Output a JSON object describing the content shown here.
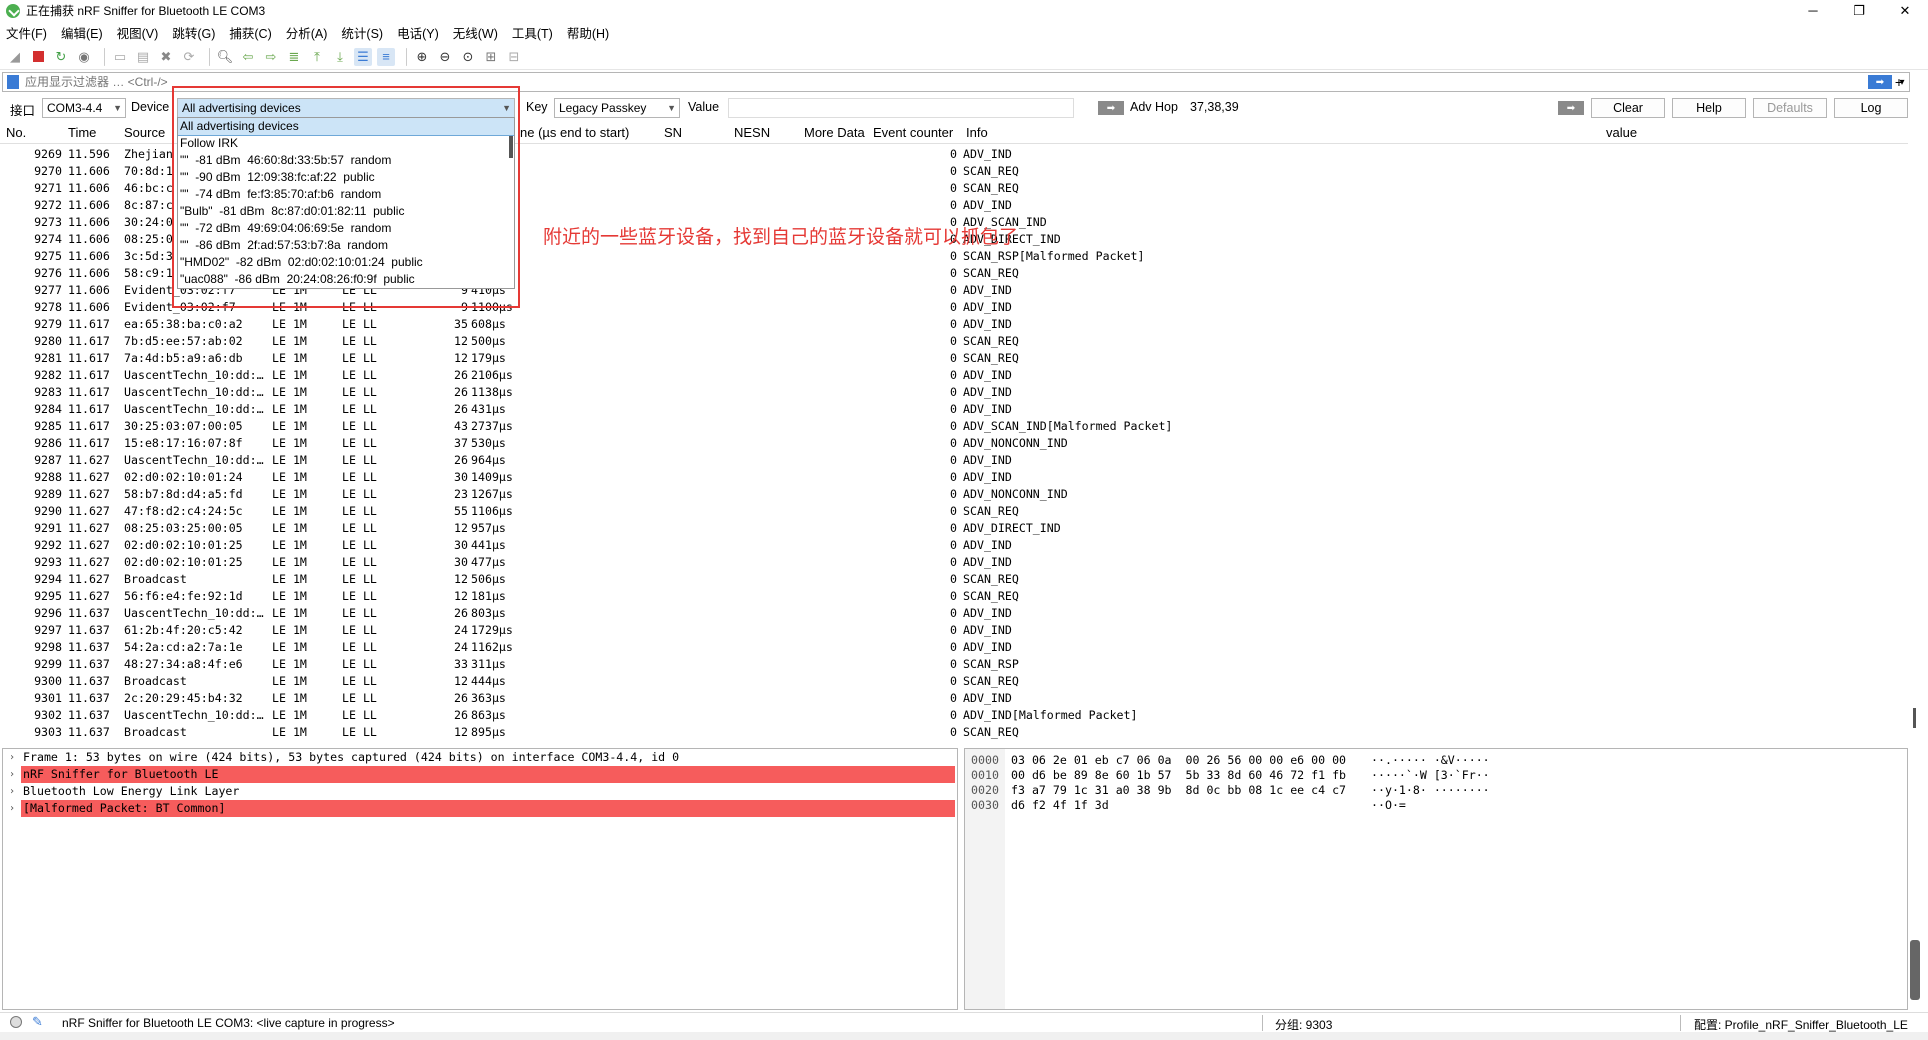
{
  "window": {
    "title": "正在捕获 nRF Sniffer for Bluetooth LE COM3",
    "controls": [
      "─",
      "❐",
      "✕"
    ]
  },
  "menu": [
    "文件(F)",
    "编辑(E)",
    "视图(V)",
    "跳转(G)",
    "捕获(C)",
    "分析(A)",
    "统计(S)",
    "电话(Y)",
    "无线(W)",
    "工具(T)",
    "帮助(H)"
  ],
  "toolbar_icons": [
    "shark-fin-icon",
    "stop-icon",
    "restart-icon",
    "options-icon",
    "open-icon",
    "save-icon",
    "close-file-icon",
    "reload-icon",
    "find-icon",
    "back-icon",
    "forward-icon",
    "goto-icon",
    "first-icon",
    "last-icon",
    "autoscroll-icon",
    "colorize-icon",
    "zoom-in-icon",
    "zoom-out-icon",
    "zoom-reset-icon",
    "resize-columns-icon",
    "layout-icon"
  ],
  "filter": {
    "placeholder": "应用显示过滤器 … <Ctrl-/>",
    "plus": "+"
  },
  "sniffer": {
    "interface_label": "接口",
    "interface_value": "COM3-4.4",
    "device_label": "Device",
    "device_value": "All advertising devices",
    "key_label": "Key",
    "key_value": "Legacy Passkey",
    "value_label": "Value",
    "adv_hop_label": "Adv Hop",
    "adv_hop_value": "37,38,39",
    "clear": "Clear",
    "help": "Help",
    "defaults": "Defaults",
    "log": "Log"
  },
  "columns": {
    "no": "No.",
    "time": "Time",
    "source": "Source",
    "delta": "ne (µs end to start)",
    "sn": "SN",
    "nesn": "NESN",
    "more_data": "More Data",
    "event_counter": "Event counter",
    "info": "Info",
    "value": "value"
  },
  "packets": [
    {
      "no": "9269",
      "time": "11.596",
      "src": "Zhejian",
      "p1": "",
      "p2": "",
      "len": "",
      "dt": "",
      "ec": "0",
      "info": "ADV_IND"
    },
    {
      "no": "9270",
      "time": "11.606",
      "src": "70:8d:1",
      "p1": "",
      "p2": "",
      "len": "",
      "dt": "",
      "ec": "0",
      "info": "SCAN_REQ"
    },
    {
      "no": "9271",
      "time": "11.606",
      "src": "46:bc:c",
      "p1": "",
      "p2": "",
      "len": "",
      "dt": "",
      "ec": "0",
      "info": "SCAN_REQ"
    },
    {
      "no": "9272",
      "time": "11.606",
      "src": "8c:87:c",
      "p1": "",
      "p2": "",
      "len": "",
      "dt": "",
      "ec": "0",
      "info": "ADV_IND"
    },
    {
      "no": "9273",
      "time": "11.606",
      "src": "30:24:0",
      "p1": "",
      "p2": "",
      "len": "",
      "dt": "",
      "ec": "0",
      "info": "ADV_SCAN_IND"
    },
    {
      "no": "9274",
      "time": "11.606",
      "src": "08:25:0",
      "p1": "",
      "p2": "",
      "len": "",
      "dt": "",
      "ec": "0",
      "info": "ADV_DIRECT_IND"
    },
    {
      "no": "9275",
      "time": "11.606",
      "src": "3c:5d:3",
      "p1": "",
      "p2": "",
      "len": "",
      "dt": "",
      "ec": "0",
      "info": "SCAN_RSP[Malformed Packet]"
    },
    {
      "no": "9276",
      "time": "11.606",
      "src": "58:c9:1",
      "p1": "",
      "p2": "",
      "len": "",
      "dt": "",
      "ec": "0",
      "info": "SCAN_REQ"
    },
    {
      "no": "9277",
      "time": "11.606",
      "src": "Evident_03:02:f7",
      "p1": "LE 1M",
      "p2": "LE LL",
      "len": "9",
      "dt": "410µs",
      "ec": "0",
      "info": "ADV_IND"
    },
    {
      "no": "9278",
      "time": "11.606",
      "src": "Evident_03:02:f7",
      "p1": "LE 1M",
      "p2": "LE LL",
      "len": "9",
      "dt": "1100µs",
      "ec": "0",
      "info": "ADV_IND"
    },
    {
      "no": "9279",
      "time": "11.617",
      "src": "ea:65:38:ba:c0:a2",
      "p1": "LE 1M",
      "p2": "LE LL",
      "len": "35",
      "dt": "608µs",
      "ec": "0",
      "info": "ADV_IND"
    },
    {
      "no": "9280",
      "time": "11.617",
      "src": "7b:d5:ee:57:ab:02",
      "p1": "LE 1M",
      "p2": "LE LL",
      "len": "12",
      "dt": "500µs",
      "ec": "0",
      "info": "SCAN_REQ"
    },
    {
      "no": "9281",
      "time": "11.617",
      "src": "7a:4d:b5:a9:a6:db",
      "p1": "LE 1M",
      "p2": "LE LL",
      "len": "12",
      "dt": "179µs",
      "ec": "0",
      "info": "SCAN_REQ"
    },
    {
      "no": "9282",
      "time": "11.617",
      "src": "UascentTechn_10:dd:…",
      "p1": "LE 1M",
      "p2": "LE LL",
      "len": "26",
      "dt": "2106µs",
      "ec": "0",
      "info": "ADV_IND"
    },
    {
      "no": "9283",
      "time": "11.617",
      "src": "UascentTechn_10:dd:…",
      "p1": "LE 1M",
      "p2": "LE LL",
      "len": "26",
      "dt": "1138µs",
      "ec": "0",
      "info": "ADV_IND"
    },
    {
      "no": "9284",
      "time": "11.617",
      "src": "UascentTechn_10:dd:…",
      "p1": "LE 1M",
      "p2": "LE LL",
      "len": "26",
      "dt": "431µs",
      "ec": "0",
      "info": "ADV_IND"
    },
    {
      "no": "9285",
      "time": "11.617",
      "src": "30:25:03:07:00:05",
      "p1": "LE 1M",
      "p2": "LE LL",
      "len": "43",
      "dt": "2737µs",
      "ec": "0",
      "info": "ADV_SCAN_IND[Malformed Packet]"
    },
    {
      "no": "9286",
      "time": "11.617",
      "src": "15:e8:17:16:07:8f",
      "p1": "LE 1M",
      "p2": "LE LL",
      "len": "37",
      "dt": "530µs",
      "ec": "0",
      "info": "ADV_NONCONN_IND"
    },
    {
      "no": "9287",
      "time": "11.627",
      "src": "UascentTechn_10:dd:…",
      "p1": "LE 1M",
      "p2": "LE LL",
      "len": "26",
      "dt": "964µs",
      "ec": "0",
      "info": "ADV_IND"
    },
    {
      "no": "9288",
      "time": "11.627",
      "src": "02:d0:02:10:01:24",
      "p1": "LE 1M",
      "p2": "LE LL",
      "len": "30",
      "dt": "1409µs",
      "ec": "0",
      "info": "ADV_IND"
    },
    {
      "no": "9289",
      "time": "11.627",
      "src": "58:b7:8d:d4:a5:fd",
      "p1": "LE 1M",
      "p2": "LE LL",
      "len": "23",
      "dt": "1267µs",
      "ec": "0",
      "info": "ADV_NONCONN_IND"
    },
    {
      "no": "9290",
      "time": "11.627",
      "src": "47:f8:d2:c4:24:5c",
      "p1": "LE 1M",
      "p2": "LE LL",
      "len": "55",
      "dt": "1106µs",
      "ec": "0",
      "info": "SCAN_REQ"
    },
    {
      "no": "9291",
      "time": "11.627",
      "src": "08:25:03:25:00:05",
      "p1": "LE 1M",
      "p2": "LE LL",
      "len": "12",
      "dt": "957µs",
      "ec": "0",
      "info": "ADV_DIRECT_IND"
    },
    {
      "no": "9292",
      "time": "11.627",
      "src": "02:d0:02:10:01:25",
      "p1": "LE 1M",
      "p2": "LE LL",
      "len": "30",
      "dt": "441µs",
      "ec": "0",
      "info": "ADV_IND"
    },
    {
      "no": "9293",
      "time": "11.627",
      "src": "02:d0:02:10:01:25",
      "p1": "LE 1M",
      "p2": "LE LL",
      "len": "30",
      "dt": "477µs",
      "ec": "0",
      "info": "ADV_IND"
    },
    {
      "no": "9294",
      "time": "11.627",
      "src": "Broadcast",
      "p1": "LE 1M",
      "p2": "LE LL",
      "len": "12",
      "dt": "506µs",
      "ec": "0",
      "info": "SCAN_REQ"
    },
    {
      "no": "9295",
      "time": "11.627",
      "src": "56:f6:e4:fe:92:1d",
      "p1": "LE 1M",
      "p2": "LE LL",
      "len": "12",
      "dt": "181µs",
      "ec": "0",
      "info": "SCAN_REQ"
    },
    {
      "no": "9296",
      "time": "11.637",
      "src": "UascentTechn_10:dd:…",
      "p1": "LE 1M",
      "p2": "LE LL",
      "len": "26",
      "dt": "803µs",
      "ec": "0",
      "info": "ADV_IND"
    },
    {
      "no": "9297",
      "time": "11.637",
      "src": "61:2b:4f:20:c5:42",
      "p1": "LE 1M",
      "p2": "LE LL",
      "len": "24",
      "dt": "1729µs",
      "ec": "0",
      "info": "ADV_IND"
    },
    {
      "no": "9298",
      "time": "11.637",
      "src": "54:2a:cd:a2:7a:1e",
      "p1": "LE 1M",
      "p2": "LE LL",
      "len": "24",
      "dt": "1162µs",
      "ec": "0",
      "info": "ADV_IND"
    },
    {
      "no": "9299",
      "time": "11.637",
      "src": "48:27:34:a8:4f:e6",
      "p1": "LE 1M",
      "p2": "LE LL",
      "len": "33",
      "dt": "311µs",
      "ec": "0",
      "info": "SCAN_RSP"
    },
    {
      "no": "9300",
      "time": "11.637",
      "src": "Broadcast",
      "p1": "LE 1M",
      "p2": "LE LL",
      "len": "12",
      "dt": "444µs",
      "ec": "0",
      "info": "SCAN_REQ"
    },
    {
      "no": "9301",
      "time": "11.637",
      "src": "2c:20:29:45:b4:32",
      "p1": "LE 1M",
      "p2": "LE LL",
      "len": "26",
      "dt": "363µs",
      "ec": "0",
      "info": "ADV_IND"
    },
    {
      "no": "9302",
      "time": "11.637",
      "src": "UascentTechn_10:dd:…",
      "p1": "LE 1M",
      "p2": "LE LL",
      "len": "26",
      "dt": "863µs",
      "ec": "0",
      "info": "ADV_IND[Malformed Packet]"
    },
    {
      "no": "9303",
      "time": "11.637",
      "src": "Broadcast",
      "p1": "LE 1M",
      "p2": "LE LL",
      "len": "12",
      "dt": "895µs",
      "ec": "0",
      "info": "SCAN_REQ"
    }
  ],
  "device_dropdown": [
    "All advertising devices",
    "Follow IRK",
    "\"\"  -81 dBm  46:60:8d:33:5b:57  random",
    "\"\"  -90 dBm  12:09:38:fc:af:22  public",
    "\"\"  -74 dBm  fe:f3:85:70:af:b6  random",
    "\"Bulb\"  -81 dBm  8c:87:d0:01:82:11  public",
    "\"\"  -72 dBm  49:69:04:06:69:5e  random",
    "\"\"  -86 dBm  2f:ad:57:53:b7:8a  random",
    "\"HMD02\"  -82 dBm  02:d0:02:10:01:24  public",
    "\"uac088\"  -86 dBm  20:24:08:26:f0:9f  public"
  ],
  "annotation": "附近的一些蓝牙设备，找到自己的蓝牙设备就可以抓包了",
  "details": [
    {
      "text": "Frame 1: 53 bytes on wire (424 bits), 53 bytes captured (424 bits) on interface COM3-4.4, id 0",
      "error": false
    },
    {
      "text": "nRF Sniffer for Bluetooth LE",
      "error": true
    },
    {
      "text": "Bluetooth Low Energy Link Layer",
      "error": false
    },
    {
      "text": "[Malformed Packet: BT Common]",
      "error": true
    }
  ],
  "bytes": [
    {
      "off": "0000",
      "hex": "03 06 2e 01 eb c7 06 0a  00 26 56 00 00 e6 00 00",
      "asc": "··.····· ·&V·····"
    },
    {
      "off": "0010",
      "hex": "00 d6 be 89 8e 60 1b 57  5b 33 8d 60 46 72 f1 fb",
      "asc": "·····`·W [3·`Fr··"
    },
    {
      "off": "0020",
      "hex": "f3 a7 79 1c 31 a0 38 9b  8d 0c bb 08 1c ee c4 c7",
      "asc": "··y·1·8· ········"
    },
    {
      "off": "0030",
      "hex": "d6 f2 4f 1f 3d",
      "asc": "··O·="
    }
  ],
  "status": {
    "capture": "nRF Sniffer for Bluetooth LE COM3: <live capture in progress>",
    "packets": "分组: 9303",
    "profile": "配置: Profile_nRF_Sniffer_Bluetooth_LE"
  }
}
